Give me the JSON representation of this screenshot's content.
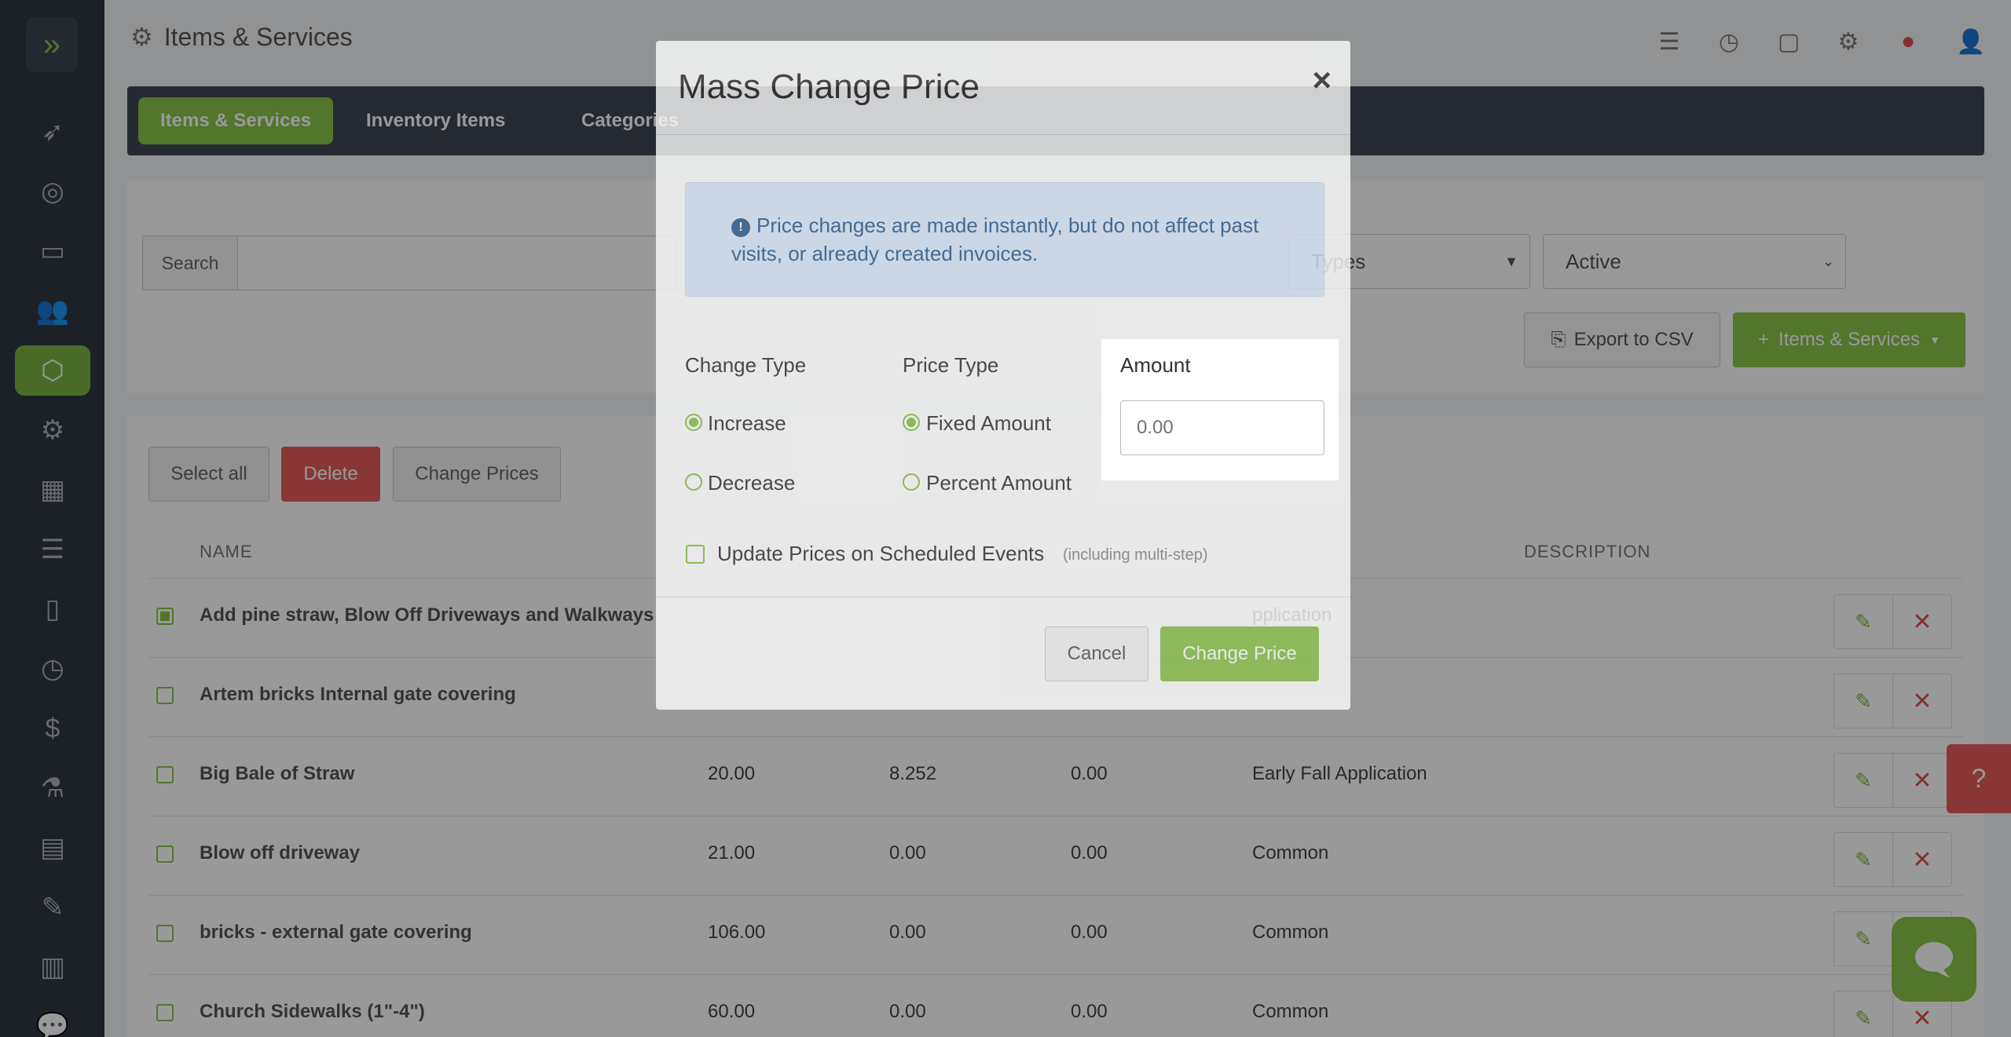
{
  "header": {
    "title": "Items & Services"
  },
  "tabs": [
    {
      "label": "Items & Services"
    },
    {
      "label": "Inventory Items"
    },
    {
      "label": "Categories"
    }
  ],
  "filters": {
    "search_label": "Search",
    "search_value": "",
    "type_select": "Types",
    "status_select": "Active",
    "export_label": "Export to CSV",
    "add_label": "Items & Services"
  },
  "actions": {
    "select_all": "Select all",
    "delete": "Delete",
    "change_prices": "Change Prices"
  },
  "table": {
    "headers": {
      "name": "NAME",
      "description": "DESCRIPTION"
    },
    "rows": [
      {
        "name": "Add pine straw, Blow Off Driveways and Walkways",
        "price": "",
        "cost": "",
        "tax": "",
        "category": "pplication",
        "checked": true
      },
      {
        "name": "Artem bricks Internal gate covering",
        "price": "",
        "cost": "",
        "tax": "",
        "category": "",
        "checked": false
      },
      {
        "name": "Big Bale of Straw",
        "price": "20.00",
        "cost": "8.252",
        "tax": "0.00",
        "category": "Early Fall Application",
        "checked": false
      },
      {
        "name": "Blow off driveway",
        "price": "21.00",
        "cost": "0.00",
        "tax": "0.00",
        "category": "Common",
        "checked": false
      },
      {
        "name": "bricks - external gate covering",
        "price": "106.00",
        "cost": "0.00",
        "tax": "0.00",
        "category": "Common",
        "checked": false
      },
      {
        "name": "Church Sidewalks (1\"-4\")",
        "price": "60.00",
        "cost": "0.00",
        "tax": "0.00",
        "category": "Common",
        "checked": false
      }
    ]
  },
  "modal": {
    "title": "Mass Change Price",
    "alert": "Price changes are made instantly, but do not affect past visits, or already created invoices.",
    "change_type": {
      "label": "Change Type",
      "options": [
        "Increase",
        "Decrease"
      ],
      "selected": "Increase"
    },
    "price_type": {
      "label": "Price Type",
      "options": [
        "Fixed Amount",
        "Percent Amount"
      ],
      "selected": "Fixed Amount"
    },
    "amount": {
      "label": "Amount",
      "placeholder": "0.00",
      "value": ""
    },
    "update_scheduled": {
      "label": "Update Prices on Scheduled Events",
      "note": "(including multi-step)",
      "checked": false
    },
    "cancel_label": "Cancel",
    "submit_label": "Change Price"
  },
  "colors": {
    "accent": "#8bc34a",
    "danger": "#e35d5b",
    "sidebar": "#2f3744"
  }
}
